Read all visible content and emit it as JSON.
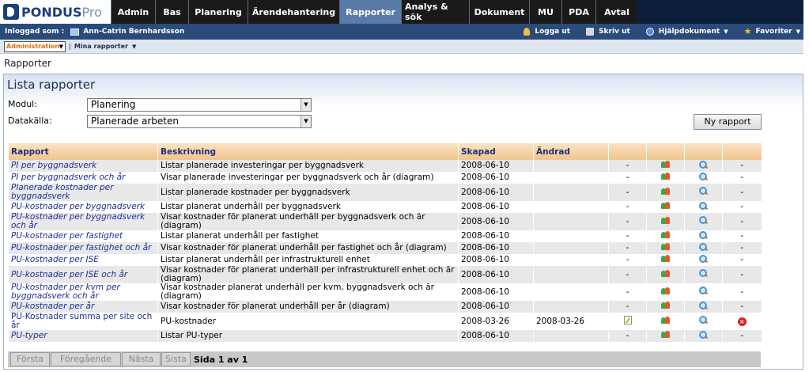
{
  "app": {
    "logo_name": "PONDUS",
    "logo_suffix": "Pro"
  },
  "nav": {
    "tabs": [
      {
        "label": "Admin"
      },
      {
        "label": "Bas"
      },
      {
        "label": "Planering"
      },
      {
        "label": "Ärendehantering"
      },
      {
        "label": "Rapporter",
        "active": true
      },
      {
        "label": "Analys & sök"
      },
      {
        "label": "Dokument"
      },
      {
        "label": "MU"
      },
      {
        "label": "PDA"
      },
      {
        "label": "Avtal"
      }
    ]
  },
  "userbar": {
    "logged_in_label": "Inloggad som :",
    "user_name": "Ann-Catrin Bernhardsson",
    "logout": "Logga ut",
    "print": "Skriv ut",
    "help": "Hjälpdokument",
    "favorites": "Favoriter"
  },
  "subbar": {
    "selected": "Administration",
    "mina": "Mina rapporter"
  },
  "breadcrumb": "Rapporter",
  "panel": {
    "title": "Lista rapporter",
    "modul_label": "Modul:",
    "modul_value": "Planering",
    "datakalla_label": "Datakälla:",
    "datakalla_value": "Planerade arbeten",
    "new_button": "Ny rapport"
  },
  "table": {
    "headers": [
      "Rapport",
      "Beskrivning",
      "Skapad",
      "Ändrad"
    ],
    "rows": [
      {
        "name": "PI per byggnadsverk",
        "desc": "Listar planerade investeringar per byggnadsverk",
        "created": "2008-06-10",
        "changed": "",
        "edit": "-",
        "del": "-"
      },
      {
        "name": "PI per byggnadsverk och år",
        "desc": "Visar planerade investeringar per byggnadsverk och år (diagram)",
        "created": "2008-06-10",
        "changed": "",
        "edit": "-",
        "del": "-"
      },
      {
        "name": "Planerade kostnader per byggnadsverk",
        "desc": "Listar planerade kostnader per byggnadsverk",
        "created": "2008-06-10",
        "changed": "",
        "edit": "-",
        "del": "-"
      },
      {
        "name": "PU-kostnader per byggnadsverk",
        "desc": "Listar planerat underhåll per byggnadsverk",
        "created": "2008-06-10",
        "changed": "",
        "edit": "-",
        "del": "-"
      },
      {
        "name": "PU-kostnader per byggnadsverk och år",
        "desc": "Visar kostnader för planerat underhåll per byggnadsverk och år (diagram)",
        "created": "2008-06-10",
        "changed": "",
        "edit": "-",
        "del": "-"
      },
      {
        "name": "PU-kostnader per fastighet",
        "desc": "Listar planerat underhåll per fastighet",
        "created": "2008-06-10",
        "changed": "",
        "edit": "-",
        "del": "-"
      },
      {
        "name": "PU-kostnader per fastighet och år",
        "desc": "Visar kostnader för planerat underhåll per fastighet och år (diagram)",
        "created": "2008-06-10",
        "changed": "",
        "edit": "-",
        "del": "-"
      },
      {
        "name": "PU-kostnader per ISE",
        "desc": "Listar planerat underhåll per infrastrukturell enhet",
        "created": "2008-06-10",
        "changed": "",
        "edit": "-",
        "del": "-"
      },
      {
        "name": "PU-kostnader per ISE och år",
        "desc": "Visar kostnader för planerat underhåll per infrastrukturell enhet och år (diagram)",
        "created": "2008-06-10",
        "changed": "",
        "edit": "-",
        "del": "-"
      },
      {
        "name": "PU-kostnader per kvm per byggnadsverk och år",
        "desc": "Visar kostnader planerat underhåll per kvm, byggnadsverk och år (diagram)",
        "created": "2008-06-10",
        "changed": "",
        "edit": "-",
        "del": "-"
      },
      {
        "name": "PU-kostnader per år",
        "desc": "Visar kostnader för planerat underhåll per år (diagram)",
        "created": "2008-06-10",
        "changed": "",
        "edit": "-",
        "del": "-"
      },
      {
        "name": "PU-Kostnader summa per site och år",
        "desc": "PU-kostnader",
        "created": "2008-03-26",
        "changed": "2008-03-26",
        "edit": "icon",
        "del": "icon",
        "upright": true
      },
      {
        "name": "PU-typer",
        "desc": "Listar PU-typer",
        "created": "2008-06-10",
        "changed": "",
        "edit": "-",
        "del": "-"
      }
    ]
  },
  "pager": {
    "first": "Första",
    "prev": "Föregående",
    "next": "Nästa",
    "last": "Sista",
    "info": "Sida 1 av 1"
  }
}
